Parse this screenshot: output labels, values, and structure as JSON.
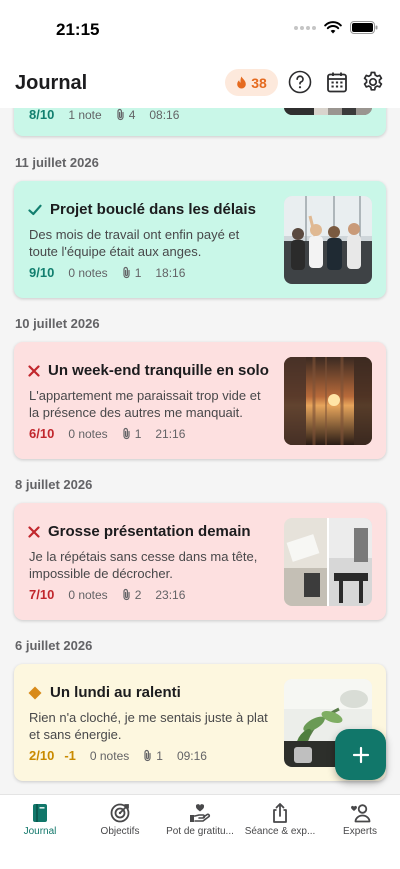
{
  "status_bar": {
    "time": "21:15"
  },
  "header": {
    "title": "Journal",
    "streak_count": "38"
  },
  "entries": [
    {
      "date": "",
      "score": "8/10",
      "notes": "1 note",
      "attachments": "4",
      "time": "08:16",
      "mood": "good"
    },
    {
      "date": "11 juillet 2026",
      "title": "Projet bouclé dans les délais",
      "description": "Des mois de travail ont enfin payé et toute l'équipe était aux anges.",
      "score": "9/10",
      "notes": "0 notes",
      "attachments": "1",
      "time": "18:16",
      "mood": "good"
    },
    {
      "date": "10 juillet 2026",
      "title": "Un week-end tranquille en solo",
      "description": "L'appartement me paraissait trop vide et la présence des autres me manquait.",
      "score": "6/10",
      "notes": "0 notes",
      "attachments": "1",
      "time": "21:16",
      "mood": "bad"
    },
    {
      "date": "8 juillet 2026",
      "title": "Grosse présentation demain",
      "description": "Je la répétais sans cesse dans ma tête, impossible de décrocher.",
      "score": "7/10",
      "notes": "0 notes",
      "attachments": "2",
      "time": "23:16",
      "mood": "bad"
    },
    {
      "date": "6 juillet 2026",
      "title": "Un lundi au ralenti",
      "description": "Rien n'a cloché, je me sentais juste à plat et sans énergie.",
      "score": "2/10",
      "delta": "-1",
      "notes": "0 notes",
      "attachments": "1",
      "time": "09:16",
      "mood": "neutral"
    }
  ],
  "tabs": [
    {
      "label": "Journal",
      "icon": "journal-icon",
      "active": true
    },
    {
      "label": "Objectifs",
      "icon": "target-icon"
    },
    {
      "label": "Pot de gratitu...",
      "icon": "gratitude-hand-icon"
    },
    {
      "label": "Séance & exp...",
      "icon": "share-upload-icon"
    },
    {
      "label": "Experts",
      "icon": "experts-icon"
    }
  ],
  "colors": {
    "accent": "#11776a",
    "good_bg": "#c9f7e8",
    "bad_bg": "#fde0e0",
    "neutral_bg": "#fdf7df",
    "streak": "#e56a1f"
  }
}
